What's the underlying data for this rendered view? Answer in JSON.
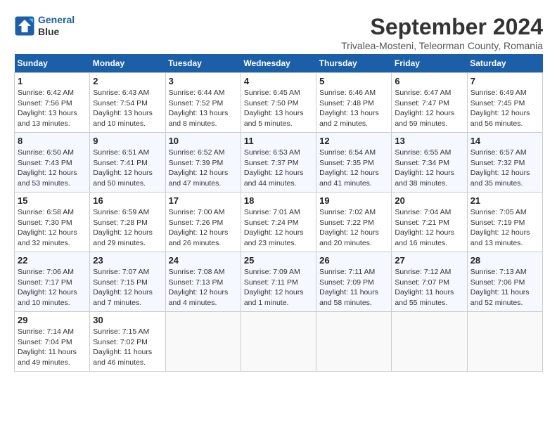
{
  "header": {
    "logo_line1": "General",
    "logo_line2": "Blue",
    "month_title": "September 2024",
    "subtitle": "Trivalea-Mosteni, Teleorman County, Romania"
  },
  "weekdays": [
    "Sunday",
    "Monday",
    "Tuesday",
    "Wednesday",
    "Thursday",
    "Friday",
    "Saturday"
  ],
  "weeks": [
    [
      {
        "day": "1",
        "sunrise": "Sunrise: 6:42 AM",
        "sunset": "Sunset: 7:56 PM",
        "daylight": "Daylight: 13 hours and 13 minutes."
      },
      {
        "day": "2",
        "sunrise": "Sunrise: 6:43 AM",
        "sunset": "Sunset: 7:54 PM",
        "daylight": "Daylight: 13 hours and 10 minutes."
      },
      {
        "day": "3",
        "sunrise": "Sunrise: 6:44 AM",
        "sunset": "Sunset: 7:52 PM",
        "daylight": "Daylight: 13 hours and 8 minutes."
      },
      {
        "day": "4",
        "sunrise": "Sunrise: 6:45 AM",
        "sunset": "Sunset: 7:50 PM",
        "daylight": "Daylight: 13 hours and 5 minutes."
      },
      {
        "day": "5",
        "sunrise": "Sunrise: 6:46 AM",
        "sunset": "Sunset: 7:48 PM",
        "daylight": "Daylight: 13 hours and 2 minutes."
      },
      {
        "day": "6",
        "sunrise": "Sunrise: 6:47 AM",
        "sunset": "Sunset: 7:47 PM",
        "daylight": "Daylight: 12 hours and 59 minutes."
      },
      {
        "day": "7",
        "sunrise": "Sunrise: 6:49 AM",
        "sunset": "Sunset: 7:45 PM",
        "daylight": "Daylight: 12 hours and 56 minutes."
      }
    ],
    [
      {
        "day": "8",
        "sunrise": "Sunrise: 6:50 AM",
        "sunset": "Sunset: 7:43 PM",
        "daylight": "Daylight: 12 hours and 53 minutes."
      },
      {
        "day": "9",
        "sunrise": "Sunrise: 6:51 AM",
        "sunset": "Sunset: 7:41 PM",
        "daylight": "Daylight: 12 hours and 50 minutes."
      },
      {
        "day": "10",
        "sunrise": "Sunrise: 6:52 AM",
        "sunset": "Sunset: 7:39 PM",
        "daylight": "Daylight: 12 hours and 47 minutes."
      },
      {
        "day": "11",
        "sunrise": "Sunrise: 6:53 AM",
        "sunset": "Sunset: 7:37 PM",
        "daylight": "Daylight: 12 hours and 44 minutes."
      },
      {
        "day": "12",
        "sunrise": "Sunrise: 6:54 AM",
        "sunset": "Sunset: 7:35 PM",
        "daylight": "Daylight: 12 hours and 41 minutes."
      },
      {
        "day": "13",
        "sunrise": "Sunrise: 6:55 AM",
        "sunset": "Sunset: 7:34 PM",
        "daylight": "Daylight: 12 hours and 38 minutes."
      },
      {
        "day": "14",
        "sunrise": "Sunrise: 6:57 AM",
        "sunset": "Sunset: 7:32 PM",
        "daylight": "Daylight: 12 hours and 35 minutes."
      }
    ],
    [
      {
        "day": "15",
        "sunrise": "Sunrise: 6:58 AM",
        "sunset": "Sunset: 7:30 PM",
        "daylight": "Daylight: 12 hours and 32 minutes."
      },
      {
        "day": "16",
        "sunrise": "Sunrise: 6:59 AM",
        "sunset": "Sunset: 7:28 PM",
        "daylight": "Daylight: 12 hours and 29 minutes."
      },
      {
        "day": "17",
        "sunrise": "Sunrise: 7:00 AM",
        "sunset": "Sunset: 7:26 PM",
        "daylight": "Daylight: 12 hours and 26 minutes."
      },
      {
        "day": "18",
        "sunrise": "Sunrise: 7:01 AM",
        "sunset": "Sunset: 7:24 PM",
        "daylight": "Daylight: 12 hours and 23 minutes."
      },
      {
        "day": "19",
        "sunrise": "Sunrise: 7:02 AM",
        "sunset": "Sunset: 7:22 PM",
        "daylight": "Daylight: 12 hours and 20 minutes."
      },
      {
        "day": "20",
        "sunrise": "Sunrise: 7:04 AM",
        "sunset": "Sunset: 7:21 PM",
        "daylight": "Daylight: 12 hours and 16 minutes."
      },
      {
        "day": "21",
        "sunrise": "Sunrise: 7:05 AM",
        "sunset": "Sunset: 7:19 PM",
        "daylight": "Daylight: 12 hours and 13 minutes."
      }
    ],
    [
      {
        "day": "22",
        "sunrise": "Sunrise: 7:06 AM",
        "sunset": "Sunset: 7:17 PM",
        "daylight": "Daylight: 12 hours and 10 minutes."
      },
      {
        "day": "23",
        "sunrise": "Sunrise: 7:07 AM",
        "sunset": "Sunset: 7:15 PM",
        "daylight": "Daylight: 12 hours and 7 minutes."
      },
      {
        "day": "24",
        "sunrise": "Sunrise: 7:08 AM",
        "sunset": "Sunset: 7:13 PM",
        "daylight": "Daylight: 12 hours and 4 minutes."
      },
      {
        "day": "25",
        "sunrise": "Sunrise: 7:09 AM",
        "sunset": "Sunset: 7:11 PM",
        "daylight": "Daylight: 12 hours and 1 minute."
      },
      {
        "day": "26",
        "sunrise": "Sunrise: 7:11 AM",
        "sunset": "Sunset: 7:09 PM",
        "daylight": "Daylight: 11 hours and 58 minutes."
      },
      {
        "day": "27",
        "sunrise": "Sunrise: 7:12 AM",
        "sunset": "Sunset: 7:07 PM",
        "daylight": "Daylight: 11 hours and 55 minutes."
      },
      {
        "day": "28",
        "sunrise": "Sunrise: 7:13 AM",
        "sunset": "Sunset: 7:06 PM",
        "daylight": "Daylight: 11 hours and 52 minutes."
      }
    ],
    [
      {
        "day": "29",
        "sunrise": "Sunrise: 7:14 AM",
        "sunset": "Sunset: 7:04 PM",
        "daylight": "Daylight: 11 hours and 49 minutes."
      },
      {
        "day": "30",
        "sunrise": "Sunrise: 7:15 AM",
        "sunset": "Sunset: 7:02 PM",
        "daylight": "Daylight: 11 hours and 46 minutes."
      },
      null,
      null,
      null,
      null,
      null
    ]
  ]
}
